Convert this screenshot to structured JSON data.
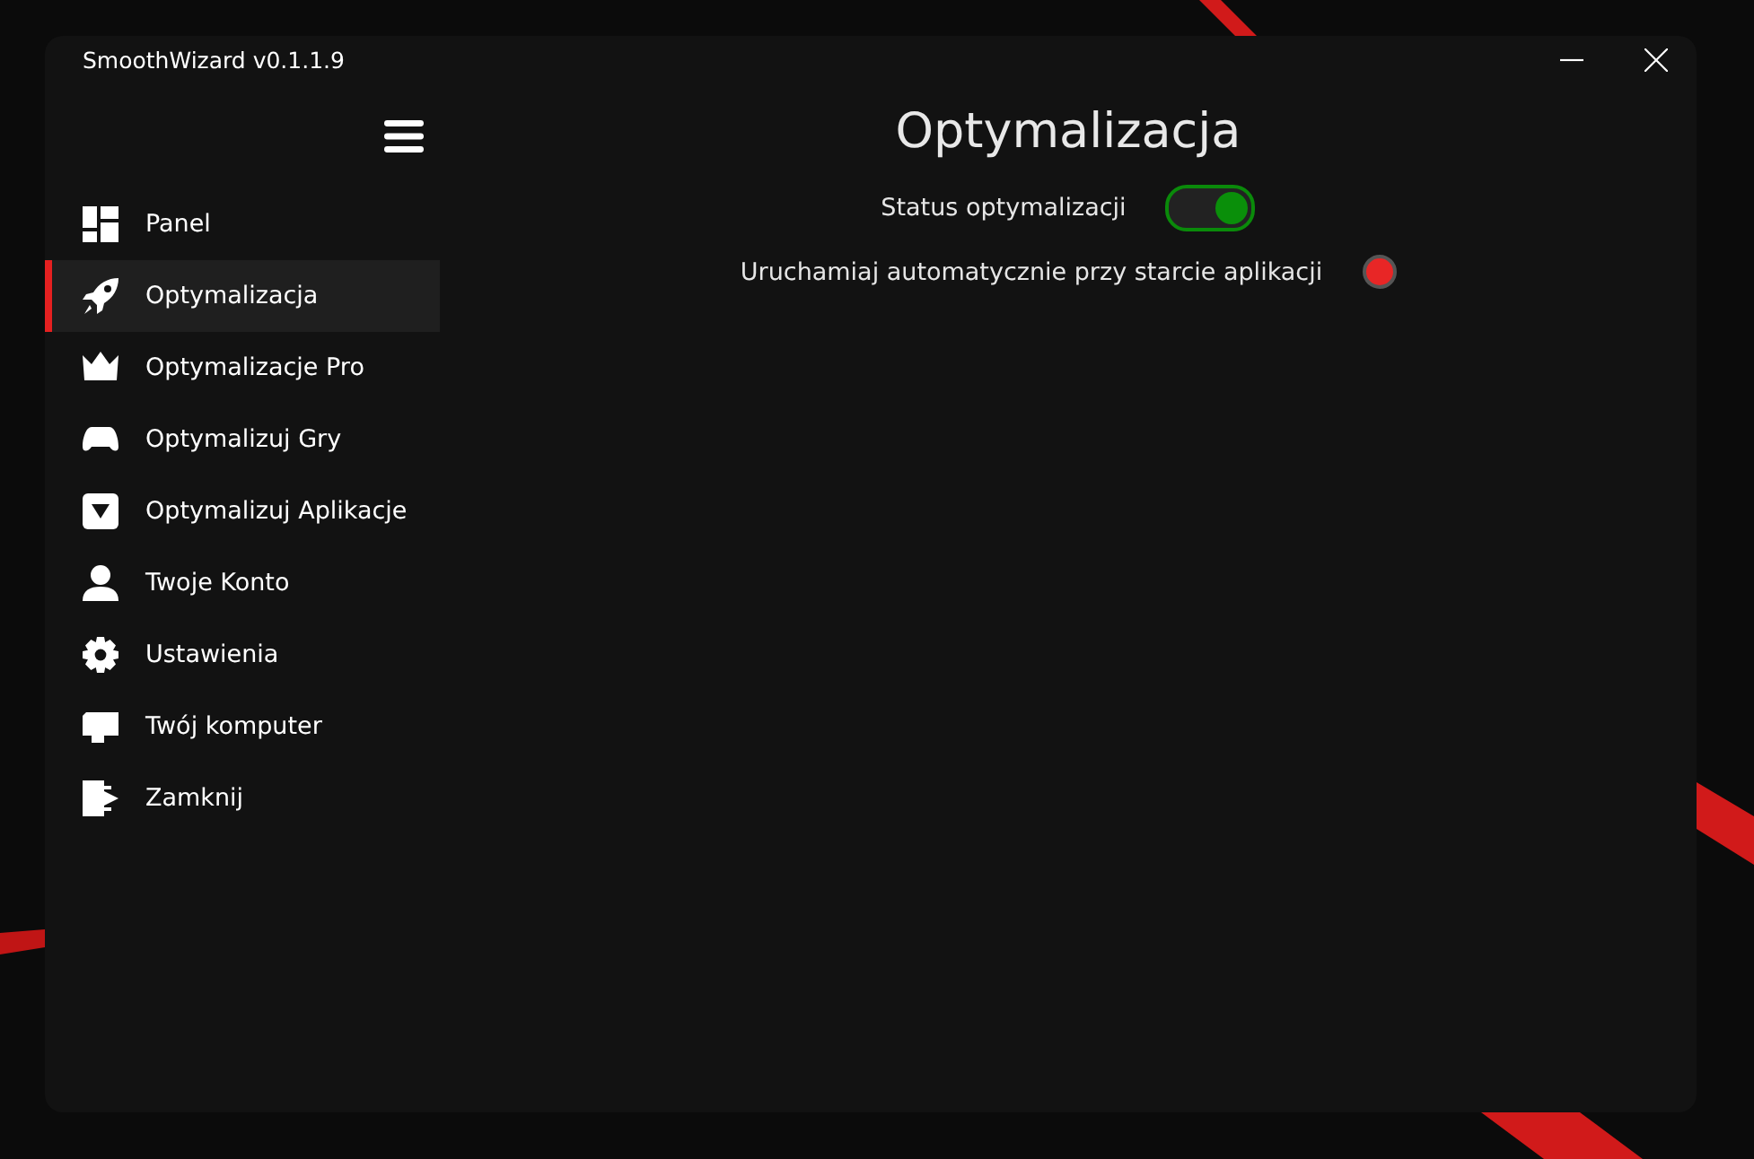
{
  "window": {
    "title": "SmoothWizard v0.1.1.9"
  },
  "sidebar": {
    "items": [
      {
        "label": "Panel",
        "selected": false
      },
      {
        "label": "Optymalizacja",
        "selected": true
      },
      {
        "label": "Optymalizacje Pro",
        "selected": false
      },
      {
        "label": "Optymalizuj Gry",
        "selected": false
      },
      {
        "label": "Optymalizuj Aplikacje",
        "selected": false
      },
      {
        "label": "Twoje Konto",
        "selected": false
      },
      {
        "label": "Ustawienia",
        "selected": false
      },
      {
        "label": "Twój komputer",
        "selected": false
      },
      {
        "label": "Zamknij",
        "selected": false
      }
    ]
  },
  "page": {
    "title": "Optymalizacja",
    "settings": [
      {
        "kind": "toggle",
        "label": "Status optymalizacji",
        "on": true
      },
      {
        "kind": "indicator",
        "label": "Uruchamiaj automatycznie przy starcie aplikacji",
        "on": false
      }
    ]
  }
}
